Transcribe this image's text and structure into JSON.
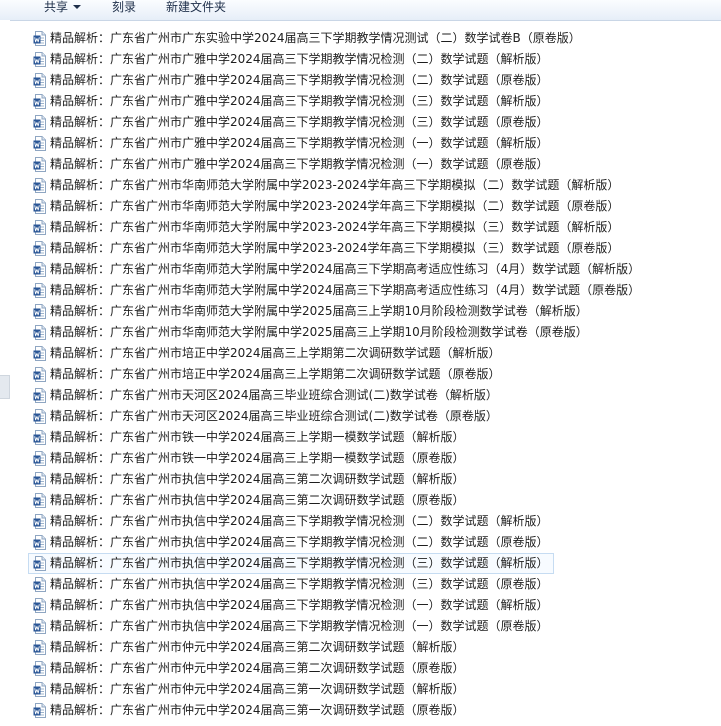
{
  "toolbar": {
    "share_label": "共享",
    "burn_label": "刻录",
    "new_folder_label": "新建文件夹"
  },
  "files": [
    {
      "name": "精品解析：广东省广州市广东实验中学2024届高三下学期教学情况测试（二）数学试卷B（原卷版）"
    },
    {
      "name": "精品解析：广东省广州市广雅中学2024届高三下学期教学情况检测（二）数学试题（解析版）"
    },
    {
      "name": "精品解析：广东省广州市广雅中学2024届高三下学期教学情况检测（二）数学试题（原卷版）"
    },
    {
      "name": "精品解析：广东省广州市广雅中学2024届高三下学期教学情况检测（三）数学试题（解析版）"
    },
    {
      "name": "精品解析：广东省广州市广雅中学2024届高三下学期教学情况检测（三）数学试题（原卷版）"
    },
    {
      "name": "精品解析：广东省广州市广雅中学2024届高三下学期教学情况检测（一）数学试题（解析版）"
    },
    {
      "name": "精品解析：广东省广州市广雅中学2024届高三下学期教学情况检测（一）数学试题（原卷版）"
    },
    {
      "name": "精品解析：广东省广州市华南师范大学附属中学2023-2024学年高三下学期模拟（二）数学试题（解析版）"
    },
    {
      "name": "精品解析：广东省广州市华南师范大学附属中学2023-2024学年高三下学期模拟（二）数学试题（原卷版）"
    },
    {
      "name": "精品解析：广东省广州市华南师范大学附属中学2023-2024学年高三下学期模拟（三）数学试题（解析版）"
    },
    {
      "name": "精品解析：广东省广州市华南师范大学附属中学2023-2024学年高三下学期模拟（三）数学试题（原卷版）"
    },
    {
      "name": "精品解析：广东省广州市华南师范大学附属中学2024届高三下学期高考适应性练习（4月）数学试题（解析版）"
    },
    {
      "name": "精品解析：广东省广州市华南师范大学附属中学2024届高三下学期高考适应性练习（4月）数学试题（原卷版）"
    },
    {
      "name": "精品解析：广东省广州市华南师范大学附属中学2025届高三上学期10月阶段检测数学试卷（解析版）"
    },
    {
      "name": "精品解析：广东省广州市华南师范大学附属中学2025届高三上学期10月阶段检测数学试卷（原卷版）"
    },
    {
      "name": "精品解析：广东省广州市培正中学2024届高三上学期第二次调研数学试题（解析版）"
    },
    {
      "name": "精品解析：广东省广州市培正中学2024届高三上学期第二次调研数学试题（原卷版）"
    },
    {
      "name": "精品解析：广东省广州市天河区2024届高三毕业班综合测试(二)数学试卷（解析版）"
    },
    {
      "name": "精品解析：广东省广州市天河区2024届高三毕业班综合测试(二)数学试卷（原卷版）"
    },
    {
      "name": "精品解析：广东省广州市铁一中学2024届高三上学期一模数学试题（解析版）"
    },
    {
      "name": "精品解析：广东省广州市铁一中学2024届高三上学期一模数学试题（原卷版）"
    },
    {
      "name": "精品解析：广东省广州市执信中学2024届高三第二次调研数学试题（解析版）"
    },
    {
      "name": "精品解析：广东省广州市执信中学2024届高三第二次调研数学试题（原卷版）"
    },
    {
      "name": "精品解析：广东省广州市执信中学2024届高三下学期教学情况检测（二）数学试题（解析版）"
    },
    {
      "name": "精品解析：广东省广州市执信中学2024届高三下学期教学情况检测（二）数学试题（原卷版）"
    },
    {
      "name": "精品解析：广东省广州市执信中学2024届高三下学期教学情况检测（三）数学试题（解析版）"
    },
    {
      "name": "精品解析：广东省广州市执信中学2024届高三下学期教学情况检测（三）数学试题（原卷版）"
    },
    {
      "name": "精品解析：广东省广州市执信中学2024届高三下学期教学情况检测（一）数学试题（解析版）"
    },
    {
      "name": "精品解析：广东省广州市执信中学2024届高三下学期教学情况检测（一）数学试题（原卷版）"
    },
    {
      "name": "精品解析：广东省广州市仲元中学2024届高三第二次调研数学试题（解析版）"
    },
    {
      "name": "精品解析：广东省广州市仲元中学2024届高三第二次调研数学试题（原卷版）"
    },
    {
      "name": "精品解析：广东省广州市仲元中学2024届高三第一次调研数学试题（解析版）"
    },
    {
      "name": "精品解析：广东省广州市仲元中学2024届高三第一次调研数学试题（原卷版）"
    }
  ],
  "focused_index": 25,
  "icon": {
    "type": "word-document-icon",
    "color": "#2b5797"
  }
}
